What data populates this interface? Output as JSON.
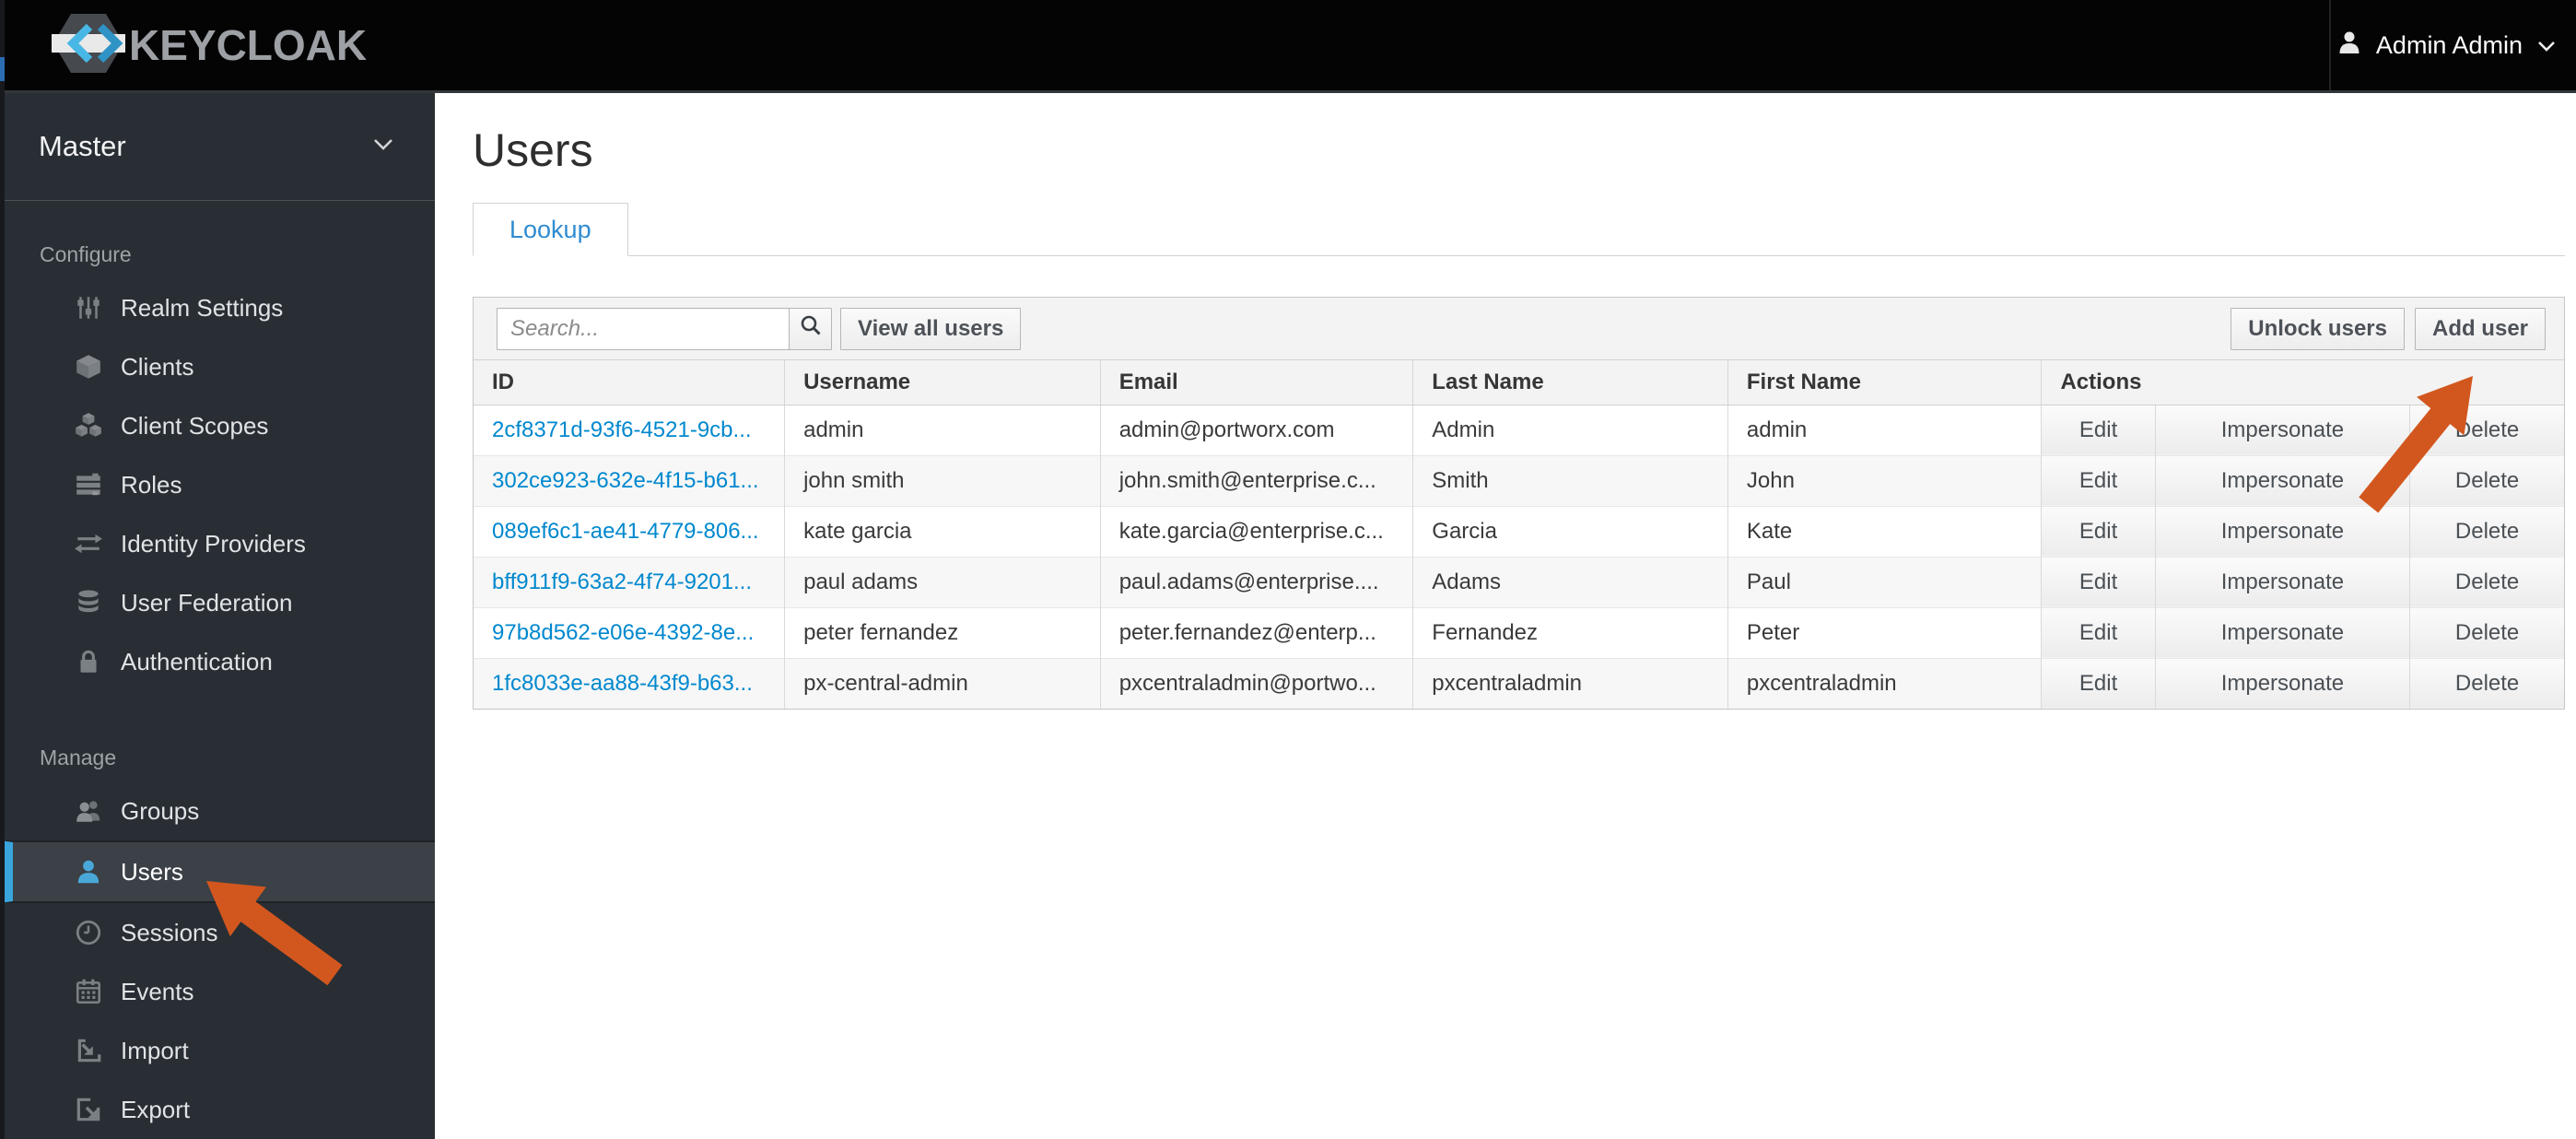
{
  "header": {
    "brand": "KEYCLOAK",
    "user": "Admin Admin"
  },
  "sidebar": {
    "realm": "Master",
    "sections": [
      {
        "label": "Configure",
        "items": [
          {
            "label": "Realm Settings",
            "icon": "sliders-icon"
          },
          {
            "label": "Clients",
            "icon": "cube-icon"
          },
          {
            "label": "Client Scopes",
            "icon": "cubes-icon"
          },
          {
            "label": "Roles",
            "icon": "list-bars-icon"
          },
          {
            "label": "Identity Providers",
            "icon": "exchange-arrows-icon"
          },
          {
            "label": "User Federation",
            "icon": "database-icon"
          },
          {
            "label": "Authentication",
            "icon": "lock-icon"
          }
        ]
      },
      {
        "label": "Manage",
        "items": [
          {
            "label": "Groups",
            "icon": "group-icon"
          },
          {
            "label": "Users",
            "icon": "user-icon",
            "active": true
          },
          {
            "label": "Sessions",
            "icon": "clock-icon"
          },
          {
            "label": "Events",
            "icon": "calendar-icon"
          },
          {
            "label": "Import",
            "icon": "import-icon"
          },
          {
            "label": "Export",
            "icon": "export-icon"
          }
        ]
      }
    ]
  },
  "main": {
    "title": "Users",
    "tab": "Lookup",
    "toolbar": {
      "search_placeholder": "Search...",
      "view_all": "View all users",
      "unlock": "Unlock users",
      "add": "Add user"
    },
    "table": {
      "columns": [
        "ID",
        "Username",
        "Email",
        "Last Name",
        "First Name",
        "Actions"
      ],
      "actions": [
        "Edit",
        "Impersonate",
        "Delete"
      ],
      "rows": [
        {
          "id": "2cf8371d-93f6-4521-9cb...",
          "username": "admin",
          "email": "admin@portworx.com",
          "last": "Admin",
          "first": "admin"
        },
        {
          "id": "302ce923-632e-4f15-b61...",
          "username": "john smith",
          "email": "john.smith@enterprise.c...",
          "last": "Smith",
          "first": "John"
        },
        {
          "id": "089ef6c1-ae41-4779-806...",
          "username": "kate garcia",
          "email": "kate.garcia@enterprise.c...",
          "last": "Garcia",
          "first": "Kate"
        },
        {
          "id": "bff911f9-63a2-4f74-9201...",
          "username": "paul adams",
          "email": "paul.adams@enterprise....",
          "last": "Adams",
          "first": "Paul"
        },
        {
          "id": "97b8d562-e06e-4392-8e...",
          "username": "peter fernandez",
          "email": "peter.fernandez@enterp...",
          "last": "Fernandez",
          "first": "Peter"
        },
        {
          "id": "1fc8033e-aa88-43f9-b63...",
          "username": "px-central-admin",
          "email": "pxcentraladmin@portwo...",
          "last": "pxcentraladmin",
          "first": "pxcentraladmin"
        }
      ]
    }
  },
  "colors": {
    "topbar_bg": "#040404",
    "sidebar_bg": "#292e34",
    "nav_selected_border": "#39a5dc",
    "link_blue": "#0088ce",
    "tab_active_blue": "#2f8bd1",
    "annotation_arrow_orange": "#d2571e"
  }
}
